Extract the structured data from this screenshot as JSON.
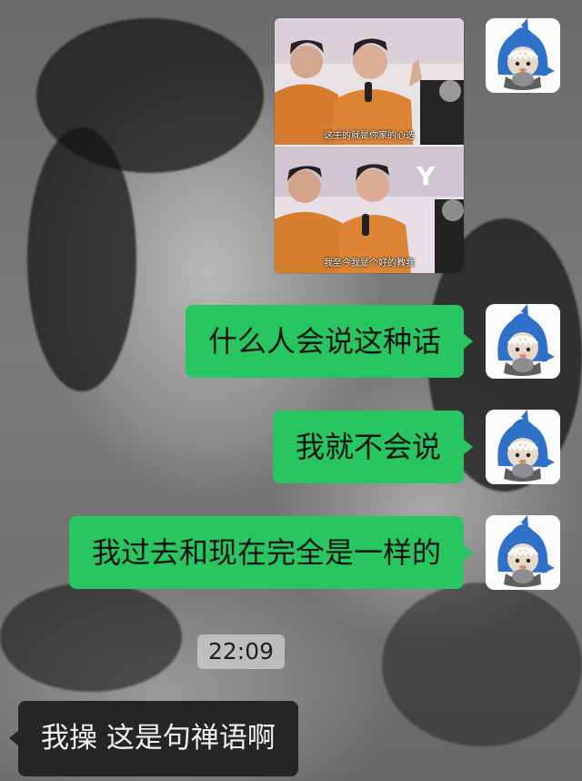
{
  "chat": {
    "messages": [
      {
        "type": "image",
        "direction": "outgoing",
        "captions": [
          "这主的就是你家的心选",
          "我至今我是个好的教我"
        ]
      },
      {
        "type": "text",
        "direction": "outgoing",
        "text": "什么人会说这种话"
      },
      {
        "type": "text",
        "direction": "outgoing",
        "text": "我就不会说"
      },
      {
        "type": "text",
        "direction": "outgoing",
        "text": "我过去和现在完全是一样的"
      },
      {
        "type": "timestamp",
        "text": "22:09"
      },
      {
        "type": "text",
        "direction": "incoming",
        "text": "我操 这是句禅语啊"
      }
    ]
  },
  "avatar": {
    "icon": "shark-hood-character-icon"
  },
  "colors": {
    "outgoing_bubble": "#27c660",
    "incoming_bubble": "#252525",
    "timestamp_bg": "#d2d2d2"
  }
}
